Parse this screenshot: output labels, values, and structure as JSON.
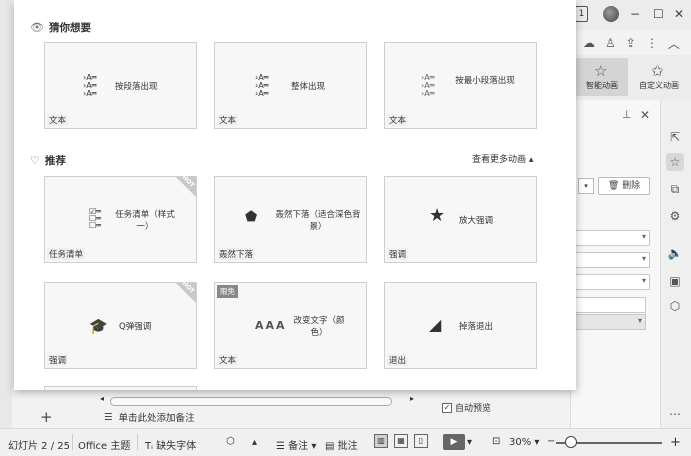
{
  "window": {
    "page_badge": "1",
    "minimize": "−",
    "maximize": "☐",
    "close": "✕"
  },
  "ribbon": {
    "smart_animation": "智能动画",
    "custom_animation": "自定义动画"
  },
  "popup": {
    "guess_section": "猜你想要",
    "recommend_section": "推荐",
    "more_link": "查看更多动画",
    "guess_cards": [
      {
        "title": "按段落出现",
        "tag": "文本"
      },
      {
        "title": "整体出现",
        "tag": "文本"
      },
      {
        "title": "按最小段落出现",
        "tag": "文本"
      }
    ],
    "recommend_cards": [
      {
        "title": "任务清单（样式一）",
        "tag": "任务清单",
        "hot": true
      },
      {
        "title": "轰然下落（适合深色背景）",
        "tag": "轰然下落",
        "hot": false
      },
      {
        "title": "放大强调",
        "tag": "强调",
        "hot": false
      },
      {
        "title": "Q弹强调",
        "tag": "强调",
        "hot": true
      },
      {
        "title": "改变文字（颜色）",
        "tag": "文本",
        "hot": false,
        "free": "限免",
        "preview_text": "AAA"
      },
      {
        "title": "掉落退出",
        "tag": "退出",
        "hot": false
      }
    ]
  },
  "right_panel": {
    "delete_button": "删除",
    "auto_preview": "自动预览"
  },
  "notes": {
    "placeholder": "单击此处添加备注"
  },
  "statusbar": {
    "slide_info": "幻灯片 2 / 25",
    "theme": "Office 主题",
    "missing_fonts": "缺失字体",
    "notes": "备注",
    "comments": "批注",
    "zoom": "30%"
  }
}
